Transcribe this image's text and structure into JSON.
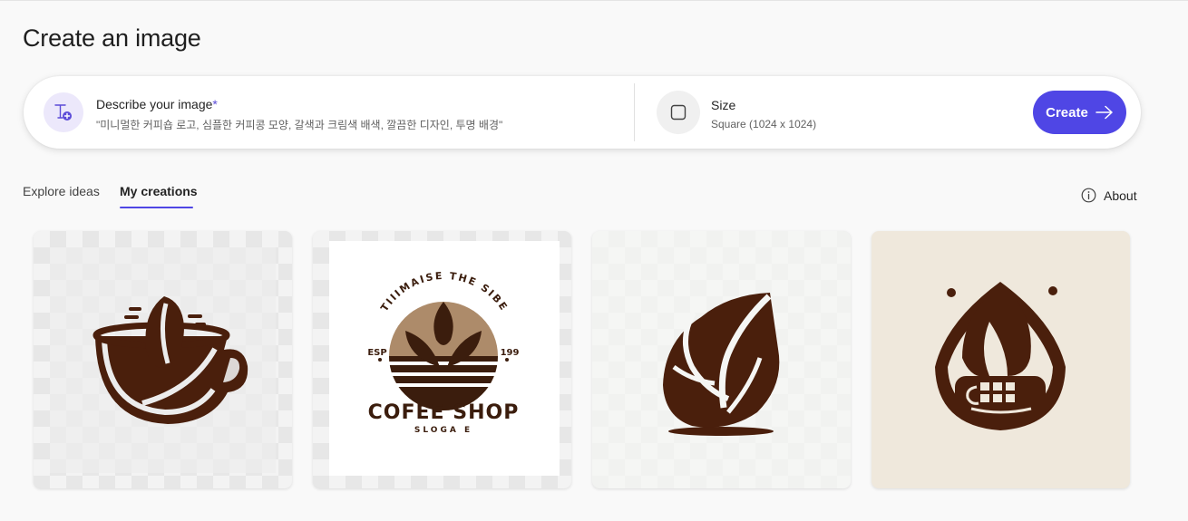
{
  "page": {
    "title": "Create an image"
  },
  "prompt": {
    "label": "Describe your image",
    "required_marker": "*",
    "value": "\"미니멀한 커피숍 로고, 심플한 커피콩 모양, 갈색과 크림색 배색, 깔끔한 디자인, 투명 배경\"",
    "icon": "text-sparkle-icon"
  },
  "size": {
    "label": "Size",
    "value": "Square (1024 x 1024)",
    "icon": "square-icon"
  },
  "create_button": {
    "label": "Create",
    "icon": "arrow-right-icon"
  },
  "tabs": [
    {
      "label": "Explore ideas",
      "active": false
    },
    {
      "label": "My creations",
      "active": true
    }
  ],
  "about": {
    "label": "About",
    "icon": "info-icon"
  },
  "creations": [
    {
      "name": "coffee-cup-bean-logo"
    },
    {
      "name": "coffee-shop-badge-logo",
      "texts": {
        "arc": "TIIIMAISE THE SIBE",
        "left": "ESP",
        "right": "199",
        "brand": "COFEE SHOP",
        "slogan": "SLOGA E"
      }
    },
    {
      "name": "coffee-bean-leaf-logo"
    },
    {
      "name": "coffee-drop-logo"
    }
  ],
  "colors": {
    "accent": "#4f46e5",
    "brown": "#4a1f0c",
    "tan": "#a98a6c",
    "cream": "#efe8dc"
  }
}
